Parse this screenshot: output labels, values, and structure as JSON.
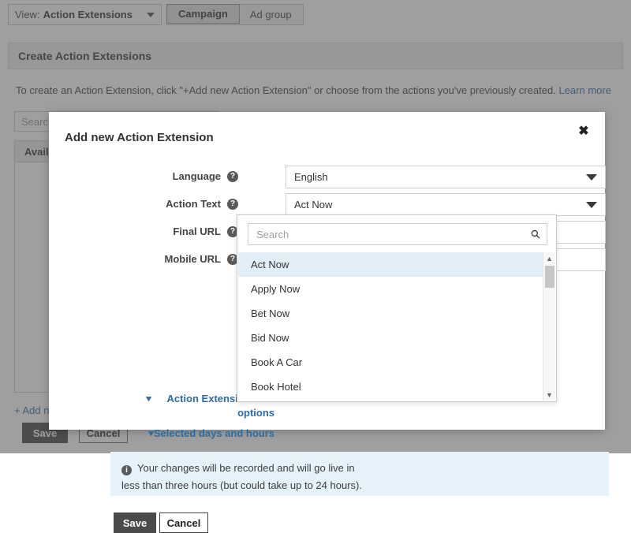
{
  "topbar": {
    "view_label": "View:",
    "view_value": "Action Extensions",
    "caret_icon": "chevron-down-icon",
    "segments": [
      {
        "label": "Campaign",
        "active": true
      },
      {
        "label": "Ad group",
        "active": false
      }
    ]
  },
  "page": {
    "section_title": "Create Action Extensions",
    "intro_text": "To create an Action Extension, click \"+Add new Action Extension\" or choose from the actions you've previously created.",
    "intro_link": "Learn more",
    "search_placeholder": "Search",
    "table_header": "Available",
    "add_new_link": "+ Add new Action Extension",
    "save_label": "Save",
    "cancel_label": "Cancel"
  },
  "modal": {
    "title": "Add new Action Extension",
    "close_icon": "close-icon",
    "fields": [
      {
        "label": "Language",
        "help_icon": "help-icon",
        "value": "English",
        "type": "select"
      },
      {
        "label": "Action Text",
        "help_icon": "help-icon",
        "value": "Act Now",
        "type": "select"
      },
      {
        "label": "Final URL",
        "help_icon": "help-icon",
        "value": "",
        "type": "text"
      },
      {
        "label": "Mobile URL",
        "help_icon": "help-icon",
        "value": "",
        "type": "text"
      }
    ],
    "collapse_url_label": "Action Extension URL options",
    "collapse_days_label": "Selected days and hours",
    "chevron_icon": "chevron-down-icon",
    "info_icon": "info-icon",
    "info_line1": "Your changes will be recorded and will go live in",
    "info_line2": "less than three hours (but could take up to 24 hours).",
    "save_label": "Save",
    "cancel_label": "Cancel"
  },
  "dropdown": {
    "search_placeholder": "Search",
    "search_value": "",
    "search_icon": "search-icon",
    "scroll_up_icon": "chevron-up-icon",
    "scroll_down_icon": "chevron-down-icon",
    "options": [
      {
        "label": "Act Now",
        "selected": true
      },
      {
        "label": "Apply Now",
        "selected": false
      },
      {
        "label": "Bet Now",
        "selected": false
      },
      {
        "label": "Bid Now",
        "selected": false
      },
      {
        "label": "Book A Car",
        "selected": false
      },
      {
        "label": "Book Hotel",
        "selected": false
      }
    ]
  },
  "colors": {
    "accent_link": "#2d6ca3",
    "selected_row": "#e3eff8",
    "info_bg": "#e6f2fa",
    "button_dark": "#4a4a4a"
  }
}
